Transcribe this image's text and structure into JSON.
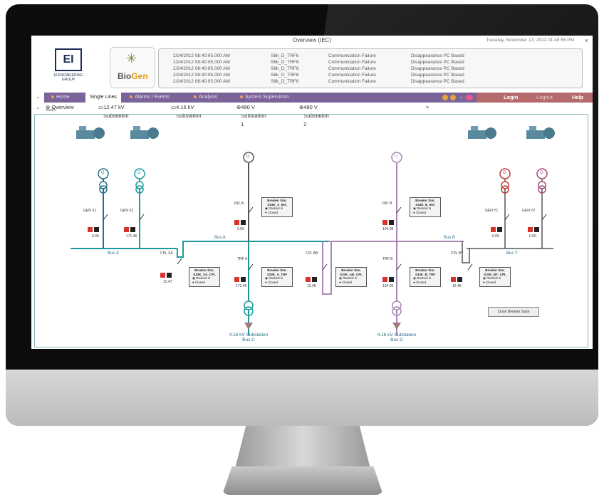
{
  "window": {
    "title": "Overview (IEC)",
    "datetime": "Tuesday, November 13, 2012 01:48:56 PM",
    "close": "×"
  },
  "logos": {
    "ei_mark": "EI",
    "ei_group": "EI ENGINEERING GROUP",
    "bio": "Bio",
    "gen": "Gen"
  },
  "alarms": [
    {
      "time": "2/24/2012 08:40:05.000 AM",
      "tag": "S6k_D_TRF6",
      "event": "Communication Failure",
      "desc": "Disappearance PC Based"
    },
    {
      "time": "2/24/2012 08:40:05.000 AM",
      "tag": "S6k_D_TRF6",
      "event": "Communication Failure",
      "desc": "Disappearance PC Based"
    },
    {
      "time": "2/24/2012 08:40:05.000 AM",
      "tag": "S6k_D_TRF6",
      "event": "Communication Failure",
      "desc": "Disappearance PC Based"
    },
    {
      "time": "2/24/2012 08:40:05.000 AM",
      "tag": "S6k_D_TRF6",
      "event": "Communication Failure",
      "desc": "Disappearance PC Based"
    },
    {
      "time": "2/24/2012 08:40:05.000 AM",
      "tag": "S6k_D_TRF6",
      "event": "Communication Failure",
      "desc": "Disappearance PC Based"
    }
  ],
  "menu": {
    "home": "Home",
    "single_lines": "Single Lines",
    "alarms": "Alarms / Events",
    "analysis": "Analysis",
    "system": "System Supervision",
    "login": "Login",
    "logout": "Logout",
    "help": "Help"
  },
  "substations": {
    "overview": "Overview",
    "s1247": "12.47 kV Substation",
    "s416": "4.16 kV Substation",
    "s480_1": "480 V Substation 1",
    "s480_2": "480 V Substation 2",
    "more": ">"
  },
  "diagram": {
    "buses": {
      "bus_x": "Bus X",
      "bus_a": "Bus A",
      "bus_b": "Bus B",
      "bus_y": "Bus Y"
    },
    "generators": {
      "gen_x1": "GEN X1",
      "gen_x2": "GEN X2",
      "gen_y1": "GEN Y1",
      "gen_y2": "GEN Y2"
    },
    "feeders": {
      "inc_a": "INC A",
      "inc_b": "INC B",
      "cpl_xa": "CPL XA",
      "cpl_ab": "CPL AB",
      "cpl_by": "CPL BY",
      "trf_a": "TRF A",
      "trf_b": "TRF B"
    },
    "gen_symbol": "G",
    "util_symbol": "U",
    "breaker_title": "Breaker Sim.",
    "breaker_racked": "Racked in",
    "breaker_closed": "Closed",
    "breakers": [
      "S33K_A_INC",
      "S33K_B_INC",
      "S33K_XA_CPL",
      "S33K_A_TRF",
      "S33K_AB_CPL",
      "S33K_B_TRF",
      "S33K_BY_CPL"
    ],
    "readings": [
      "0.00",
      "171.46",
      "0.00",
      "104.05",
      "0.00",
      "0.00",
      "12.47",
      "171.45",
      "12.46",
      "104.05",
      "12.46"
    ],
    "unit": "Amps",
    "sub_c": "4.16 kV Substation",
    "sub_c_bus": "Bus C",
    "sub_d": "4.16 kV Substation",
    "sub_d_bus": "Bus D",
    "control_button": "Close Breaker State"
  },
  "colors": {
    "teal": "#1a9a9a",
    "blue": "#2a6e8a",
    "purple": "#a886b6",
    "magenta": "#a84b7d",
    "red_gen": "#c23a3a",
    "util_gray": "#555555",
    "menu": "#7a6399",
    "login": "#b46a6a"
  }
}
